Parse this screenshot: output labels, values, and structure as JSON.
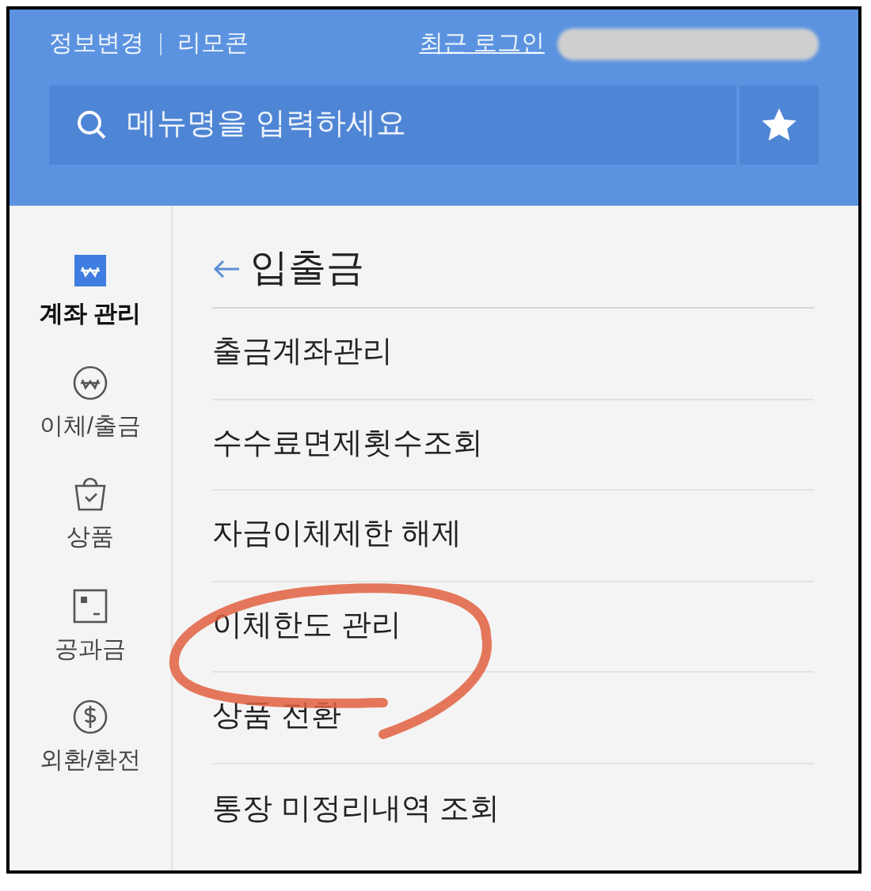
{
  "header": {
    "links": [
      {
        "label": "정보변경"
      },
      {
        "label": "리모콘"
      }
    ],
    "recent_login": "최근 로그인"
  },
  "search": {
    "placeholder": "메뉴명을 입력하세요"
  },
  "sidebar": {
    "items": [
      {
        "label": "계좌 관리",
        "selected": true
      },
      {
        "label": "이체/출금",
        "selected": false
      },
      {
        "label": "상품",
        "selected": false
      },
      {
        "label": "공과금",
        "selected": false
      },
      {
        "label": "외환/환전",
        "selected": false
      }
    ]
  },
  "section": {
    "title": "입출금",
    "items": [
      {
        "label": "출금계좌관리"
      },
      {
        "label": "수수료면제횟수조회"
      },
      {
        "label": "자금이체제한 해제"
      },
      {
        "label": "이체한도 관리"
      },
      {
        "label": "상품 전환"
      },
      {
        "label": "통장 미정리내역 조회"
      }
    ]
  }
}
